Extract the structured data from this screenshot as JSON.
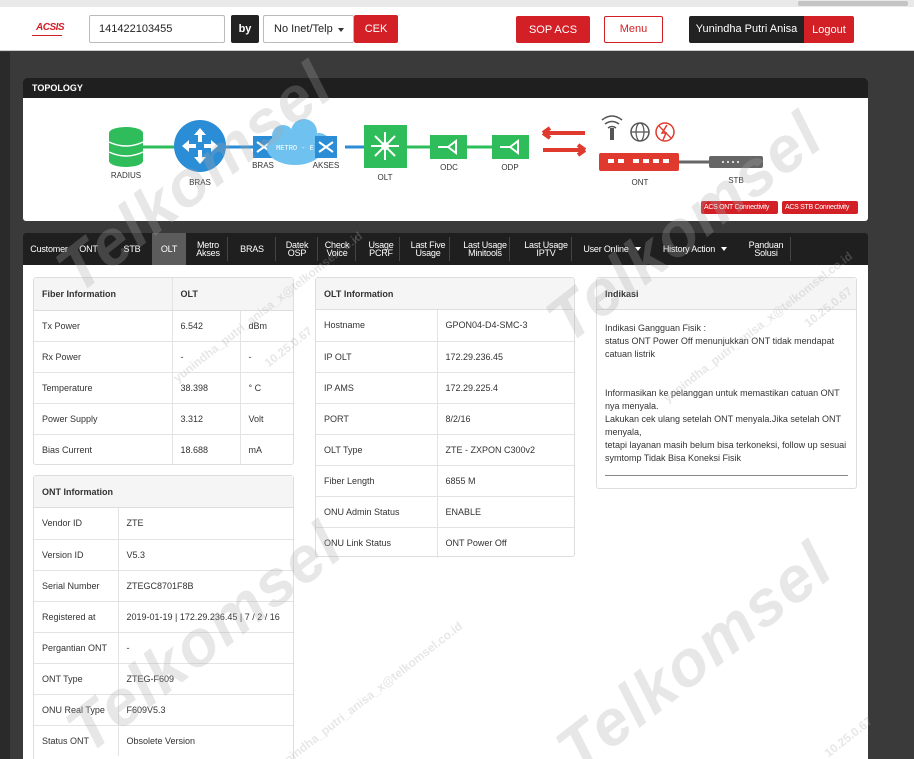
{
  "header": {
    "logo": "ACSIS",
    "search_value": "141422103455",
    "by_label": "by",
    "search_by": "No Inet/Telp",
    "cek_label": "CEK",
    "sop_label": "SOP ACS",
    "menu_label": "Menu",
    "user_name": "Yunindha Putri Anisa",
    "logout_label": "Logout"
  },
  "topology": {
    "title": "TOPOLOGY",
    "nodes": {
      "radius": "RADIUS",
      "bras": "BRAS",
      "bras2": "BRAS",
      "metro": "METRO - E",
      "akses": "AKSES",
      "olt": "OLT",
      "odc": "ODC",
      "odp": "ODP",
      "ont": "ONT",
      "stb": "STB"
    },
    "acs_ont_label": "ACS ONT Connectivity",
    "acs_stb_label": "ACS STB Connectivity",
    "colors": {
      "green": "#2ebd5a",
      "blue": "#2b8dd6",
      "red": "#e03a2f",
      "gray": "#666666"
    }
  },
  "tabs": [
    {
      "label": "Customer"
    },
    {
      "label": "ONT"
    },
    {
      "label": "STB"
    },
    {
      "label": "OLT"
    },
    {
      "label1": "Metro",
      "label2": "Akses"
    },
    {
      "label": "BRAS"
    },
    {
      "label1": "Datek",
      "label2": "OSP"
    },
    {
      "label1": "Check",
      "label2": "Voice"
    },
    {
      "label1": "Usage",
      "label2": "PCRF"
    },
    {
      "label1": "Last Five",
      "label2": "Usage"
    },
    {
      "label1": "Last Usage",
      "label2": "Minitools"
    },
    {
      "label1": "Last Usage",
      "label2": "IPTV"
    },
    {
      "label": "User Online"
    },
    {
      "label": "History Action"
    },
    {
      "label1": "Panduan",
      "label2": "Solusi"
    }
  ],
  "fiber": {
    "head1": "Fiber Information",
    "head2": "OLT",
    "rows": [
      {
        "label": "Tx Power",
        "value": "6.542",
        "unit": "dBm"
      },
      {
        "label": "Rx Power",
        "value": "-",
        "unit": "-"
      },
      {
        "label": "Temperature",
        "value": "38.398",
        "unit": "° C"
      },
      {
        "label": "Power Supply",
        "value": "3.312",
        "unit": "Volt"
      },
      {
        "label": "Bias Current",
        "value": "18.688",
        "unit": "mA"
      }
    ]
  },
  "ont_info": {
    "title": "ONT Information",
    "rows": [
      {
        "label": "Vendor ID",
        "value": "ZTE"
      },
      {
        "label": "Version ID",
        "value": "V5.3"
      },
      {
        "label": "Serial Number",
        "value": "ZTEGC8701F8B"
      },
      {
        "label": "Registered at",
        "value": "2019-01-19 | 172.29.236.45 | 7 / 2 / 16"
      },
      {
        "label": "Pergantian ONT",
        "value": "-"
      },
      {
        "label": "ONT Type",
        "value": "ZTEG-F609"
      },
      {
        "label": "ONU Real Type",
        "value": "F609V5.3"
      },
      {
        "label": "Status ONT",
        "value": "Obsolete Version"
      }
    ]
  },
  "olt_info": {
    "title": "OLT Information",
    "rows": [
      {
        "label": "Hostname",
        "value": "GPON04-D4-SMC-3"
      },
      {
        "label": "IP OLT",
        "value": "172.29.236.45"
      },
      {
        "label": "IP AMS",
        "value": "172.29.225.4"
      },
      {
        "label": "PORT",
        "value": "8/2/16"
      },
      {
        "label": "OLT Type",
        "value": "ZTE - ZXPON C300v2"
      },
      {
        "label": "Fiber Length",
        "value": "6855 M"
      },
      {
        "label": "ONU Admin Status",
        "value": "ENABLE"
      },
      {
        "label": "ONU Link Status",
        "value": "ONT Power Off"
      }
    ]
  },
  "indikasi": {
    "title": "Indikasi",
    "line1": "Indikasi Gangguan Fisik :",
    "line2": "status ONT Power Off menunjukkan ONT tidak mendapat catuan listrik",
    "line3": "Informasikan ke pelanggan untuk memastikan catuan ONT nya menyala.",
    "line4": "Lakukan cek ulang setelah ONT menyala.Jika setelah ONT menyala,",
    "line5": "tetapi layanan masih belum bisa terkoneksi, follow up sesuai symtomp Tidak Bisa Koneksi Fisik"
  },
  "watermark": {
    "brand": "Telkomsel",
    "email": "yunindha_putri_anisa_x@telkomsel.co.id",
    "ip": "10.25.0.67"
  }
}
